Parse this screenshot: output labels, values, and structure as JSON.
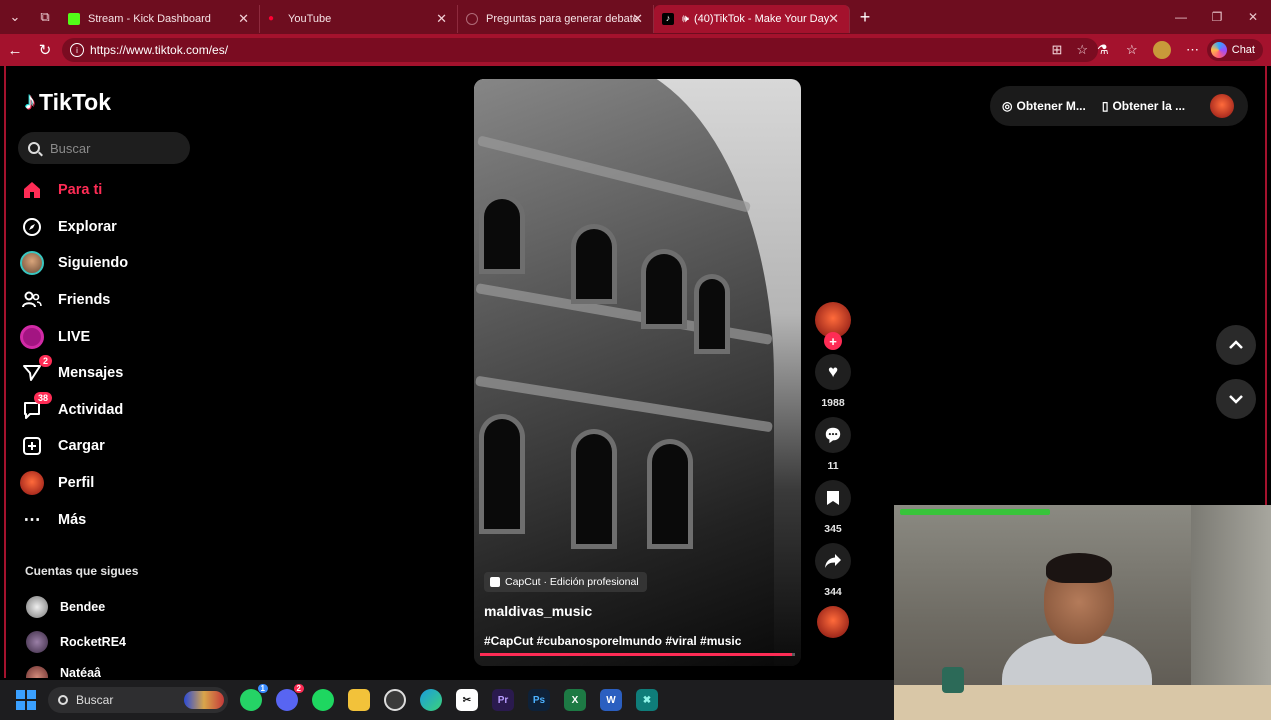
{
  "browser": {
    "tabs": [
      {
        "label": "Stream - Kick Dashboard",
        "favicon_color": "#53fc18"
      },
      {
        "label": "YouTube",
        "favicon_color": "#ff0033"
      },
      {
        "label": "Preguntas para generar debate",
        "favicon_color": "#b06b78"
      },
      {
        "label": "(40)TikTok - Make Your Day",
        "favicon_color": "#000000"
      }
    ],
    "url": "https://www.tiktok.com/es/",
    "chat_label": "Chat"
  },
  "sidebar": {
    "logo_text": "TikTok",
    "search_placeholder": "Buscar",
    "items": [
      {
        "label": "Para ti",
        "icon": "home-icon"
      },
      {
        "label": "Explorar",
        "icon": "compass-icon"
      },
      {
        "label": "Siguiendo",
        "icon": "avatar-icon"
      },
      {
        "label": "Friends",
        "icon": "friends-icon"
      },
      {
        "label": "LIVE",
        "icon": "live-icon"
      },
      {
        "label": "Mensajes",
        "icon": "messages-icon",
        "badge": "2"
      },
      {
        "label": "Actividad",
        "icon": "activity-icon",
        "badge": "38"
      },
      {
        "label": "Cargar",
        "icon": "upload-icon"
      },
      {
        "label": "Perfil",
        "icon": "profile-icon"
      },
      {
        "label": "Más",
        "icon": "more-icon"
      }
    ],
    "following_header": "Cuentas que sigues",
    "following": [
      {
        "name": "Bendee"
      },
      {
        "name": "RocketRE4"
      },
      {
        "name": "Natéaâ"
      }
    ]
  },
  "video": {
    "capcut_label": "CapCut · Edición profesional",
    "author": "maldivas_music",
    "tags": "#CapCut #cubanosporelmundo #viral #music",
    "progress": 0.99,
    "likes": "1988",
    "comments": "11",
    "saves": "345",
    "shares": "344"
  },
  "top_right": {
    "item1": "Obtener M...",
    "item2": "Obtener la ..."
  },
  "taskbar": {
    "search_label": "Buscar",
    "whatsapp_badge": "1",
    "discord_badge": "2"
  },
  "colors": {
    "accent": "#fe2c55",
    "browser_frame": "#a4122d"
  }
}
